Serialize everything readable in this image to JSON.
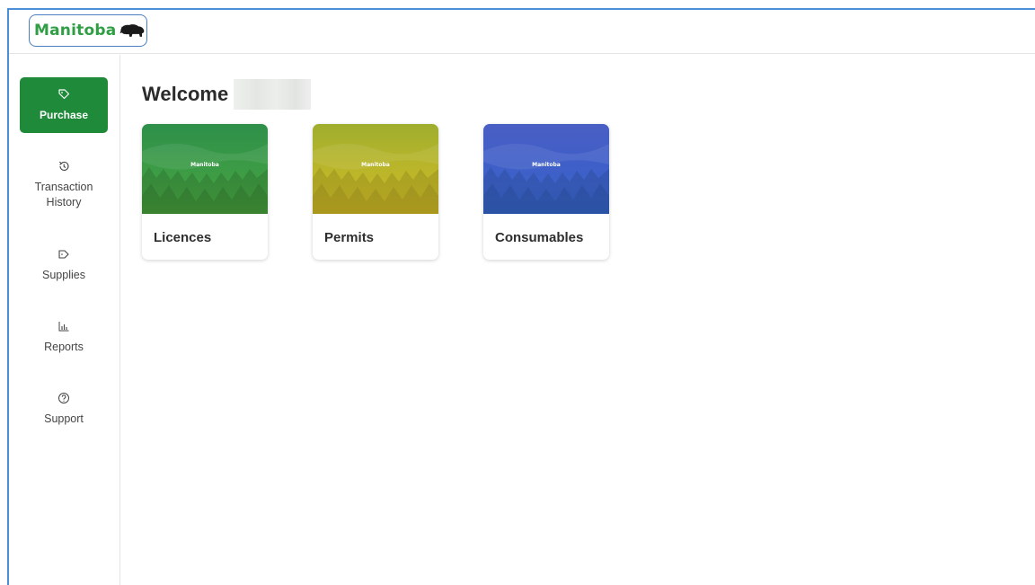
{
  "header": {
    "logo_text": "Manitoba",
    "logo_icon": "bison-icon"
  },
  "sidebar": {
    "items": [
      {
        "label": "Purchase",
        "icon": "tag-icon",
        "active": true
      },
      {
        "label": "Transaction History",
        "icon": "history-icon",
        "active": false
      },
      {
        "label": "Supplies",
        "icon": "tag-icon",
        "active": false
      },
      {
        "label": "Reports",
        "icon": "bar-chart-icon",
        "active": false
      },
      {
        "label": "Support",
        "icon": "help-circle-icon",
        "active": false
      }
    ]
  },
  "main": {
    "welcome": "Welcome",
    "cards": [
      {
        "label": "Licences",
        "brand": "Manitoba",
        "color": "#3a9a46"
      },
      {
        "label": "Permits",
        "brand": "Manitoba",
        "color": "#b8b52a"
      },
      {
        "label": "Consumables",
        "brand": "Manitoba",
        "color": "#3f5fc8"
      }
    ]
  },
  "colors": {
    "accent_green": "#1f8a3a",
    "frame_blue": "#4a90d9",
    "logo_green": "#2f9e44"
  }
}
